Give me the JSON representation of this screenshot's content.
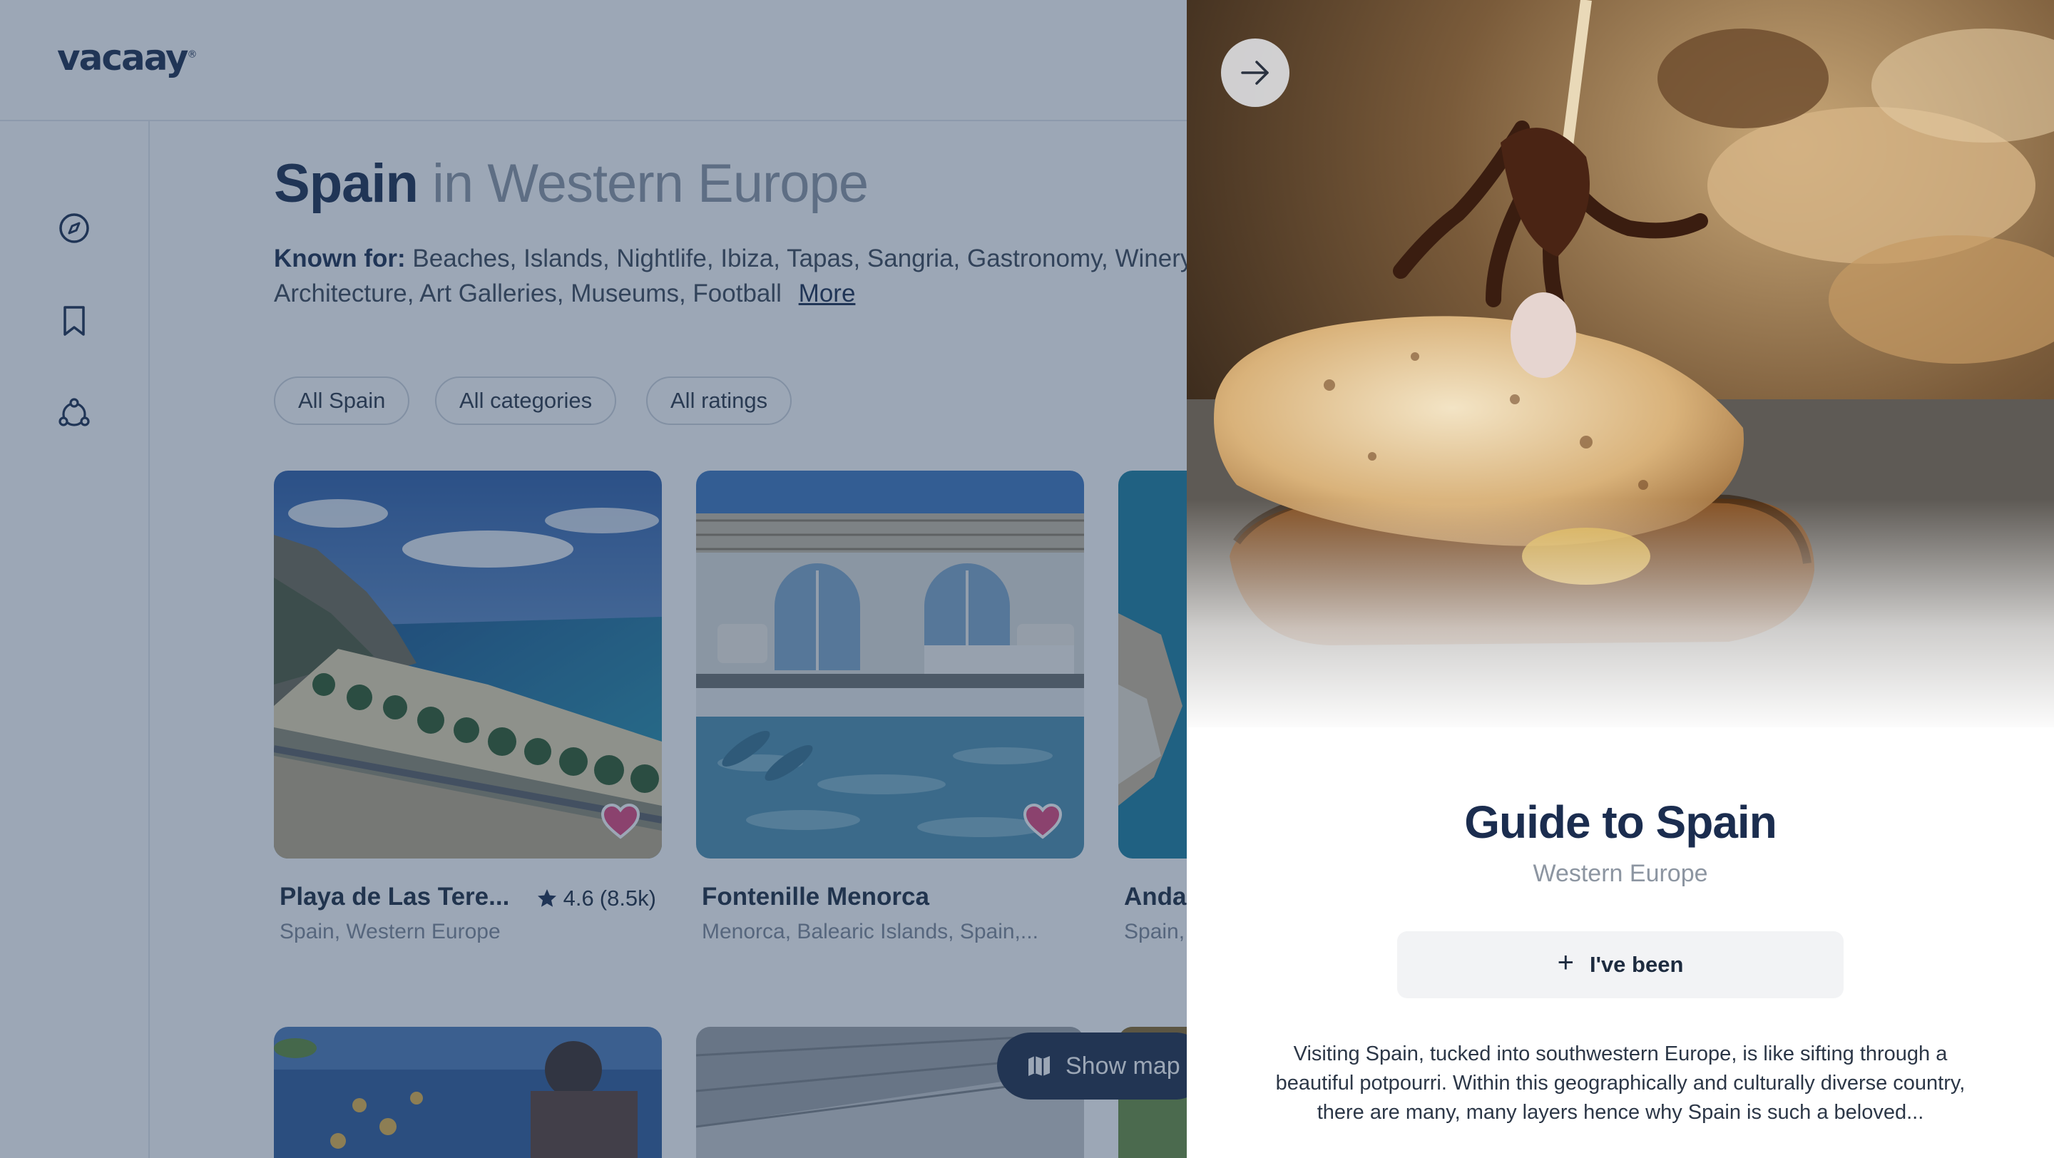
{
  "app": {
    "logo": "vacaay",
    "logo_mark": "®"
  },
  "sidebar": {
    "items": [
      {
        "icon": "compass-icon",
        "label": "Explore"
      },
      {
        "icon": "bookmark-icon",
        "label": "Saved"
      },
      {
        "icon": "share-icon",
        "label": "Share"
      }
    ]
  },
  "header": {
    "country": "Spain",
    "region": "in Western Europe",
    "known_label": "Known for:",
    "known_list": "Beaches, Islands, Nightlife, Ibiza, Tapas, Sangria, Gastronomy, Winery, Architecture, Art Galleries, Museums, Football",
    "more_link": "More"
  },
  "filters": {
    "region": "All Spain",
    "categories": "All categories",
    "ratings": "All ratings"
  },
  "cards": [
    {
      "name": "Playa de Las Tere...",
      "location": "Spain, Western Europe",
      "rating": "4.6",
      "reviews": "(8.5k)",
      "favorited": true
    },
    {
      "name": "Fontenille Menorca",
      "location": "Menorca, Balearic Islands, Spain,...",
      "favorited": true
    },
    {
      "name": "Anda",
      "location": "Spain,"
    }
  ],
  "show_map": {
    "label": "Show map"
  },
  "panel": {
    "title": "Guide to Spain",
    "subtitle": "Western Europe",
    "been_label": "I've been",
    "description": "Visiting Spain, tucked into southwestern Europe, is like sifting through a beautiful potpourri. Within this geographically and culturally diverse country, there are many, many layers hence why Spain is such a beloved..."
  },
  "colors": {
    "brand": "#1b2d4f",
    "overlay": "#284060",
    "heart": "#e0457b",
    "map_button": "#1e2d48"
  }
}
